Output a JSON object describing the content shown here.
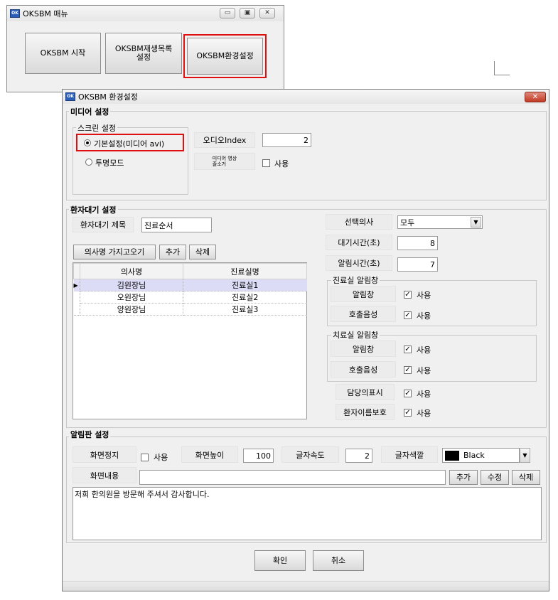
{
  "menu_window": {
    "title": "OKSBM 매뉴",
    "buttons": [
      "OKSBM 시작",
      "OKSBM재생목록\n설정",
      "OKSBM환경설정"
    ]
  },
  "settings_window": {
    "title": "OKSBM 환경설정",
    "close_label": "x",
    "media": {
      "group_label": "미디어 설정",
      "screen_group_label": "스크린 설정",
      "radio_default": "기본설정(미디어 avi)",
      "radio_transparent": "투명모드",
      "audio_index_label": "오디오Index",
      "audio_index_value": "2",
      "media_remove_label": "미디어 영상\n줄소거",
      "use_label": "사용"
    },
    "waiting": {
      "group_label": "환자대기 설정",
      "title_label": "환자대기 제목",
      "title_value": "진료순서",
      "btn_fetch": "의사명 가지고오기",
      "btn_add": "추가",
      "btn_delete": "삭제",
      "columns": [
        "의사명",
        "진료실명"
      ],
      "rows": [
        {
          "doctor": "김원장님",
          "room": "진료실1"
        },
        {
          "doctor": "오원장님",
          "room": "진료실2"
        },
        {
          "doctor": "양원장님",
          "room": "진료실3"
        }
      ],
      "select_doctor_label": "선택의사",
      "select_doctor_value": "모두",
      "wait_time_label": "대기시간(초)",
      "wait_time_value": "8",
      "alert_time_label": "알림시간(초)",
      "alert_time_value": "7",
      "clinic_alert_group": "진료실 알림창",
      "treat_alert_group": "치료실 알림창",
      "alert_label": "알림창",
      "call_sound_label": "호출음성",
      "use_label": "사용",
      "show_doctor_label": "담당의표시",
      "privacy_label": "환자이름보호"
    },
    "board": {
      "group_label": "알림판 설정",
      "stop_label": "화면정지",
      "use_label": "사용",
      "height_label": "화면높이",
      "height_value": "100",
      "speed_label": "글자속도",
      "speed_value": "2",
      "color_label": "글자색깔",
      "color_value": "Black",
      "content_label": "화면내용",
      "content_input": "",
      "btn_add": "추가",
      "btn_edit": "수정",
      "btn_delete": "삭제",
      "message": "저희 한의원을 방문해 주셔서 감사합니다."
    },
    "ok_label": "확인",
    "cancel_label": "취소"
  },
  "colors": {
    "highlight": "#e01010",
    "selected_row": "#dcdcf6",
    "dialog_bg": "#f0f0f0"
  }
}
